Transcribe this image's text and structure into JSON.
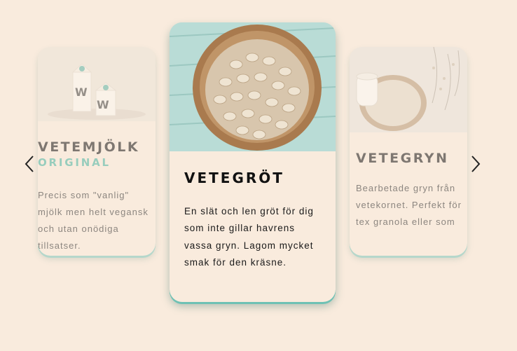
{
  "carousel": {
    "prev_icon": "chevron-left-icon",
    "next_icon": "chevron-right-icon",
    "cards": [
      {
        "title": "VETEMJÖLK",
        "subtitle": "ORIGINAL",
        "text": "Precis som \"vanlig\" mjölk men helt vegansk och utan onödiga tillsatser."
      },
      {
        "title": "VETEGRÖT",
        "text": "En slät och len gröt för dig som inte gillar havrens vassa gryn. Lagom mycket smak för den kräsne."
      },
      {
        "title": "VETEGRYN",
        "text": "Bearbetade gryn från vetekornet. Perfekt för tex granola eller som"
      }
    ]
  },
  "colors": {
    "background": "#f9ebdd",
    "accent": "#49b5a3",
    "card_shadow": "#6ec1b4"
  },
  "images": {
    "left": "milk-cartons-image",
    "center": "wheat-flakes-bowl-image",
    "right": "milk-jug-and-grains-image"
  }
}
